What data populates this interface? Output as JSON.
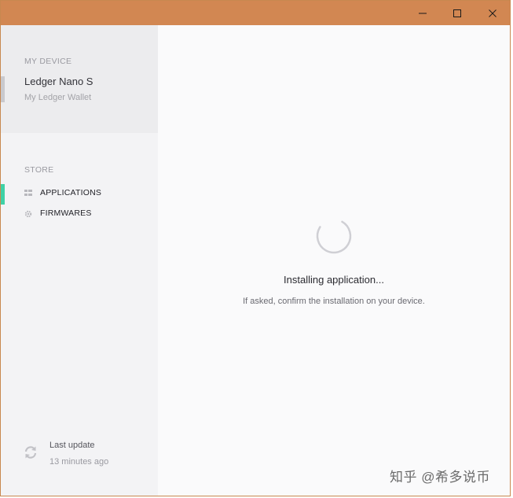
{
  "window": {
    "controls": {
      "minimize_icon": "minimize-icon",
      "maximize_icon": "maximize-icon",
      "close_icon": "close-icon"
    },
    "titlebar_color": "#d28752"
  },
  "sidebar": {
    "device_section_label": "MY DEVICE",
    "device_name": "Ledger Nano S",
    "device_subtitle": "My Ledger Wallet",
    "store_section_label": "STORE",
    "items": [
      {
        "label": "APPLICATIONS",
        "icon": "grid-icon",
        "active": true
      },
      {
        "label": "FIRMWARES",
        "icon": "gear-icon",
        "active": false
      }
    ],
    "last_update_label": "Last update",
    "last_update_time": "13 minutes ago",
    "active_color": "#3fd1a6"
  },
  "main": {
    "status_title": "Installing application...",
    "status_message": "If asked, confirm the installation on your device."
  },
  "watermark": "知乎 @希多说币"
}
